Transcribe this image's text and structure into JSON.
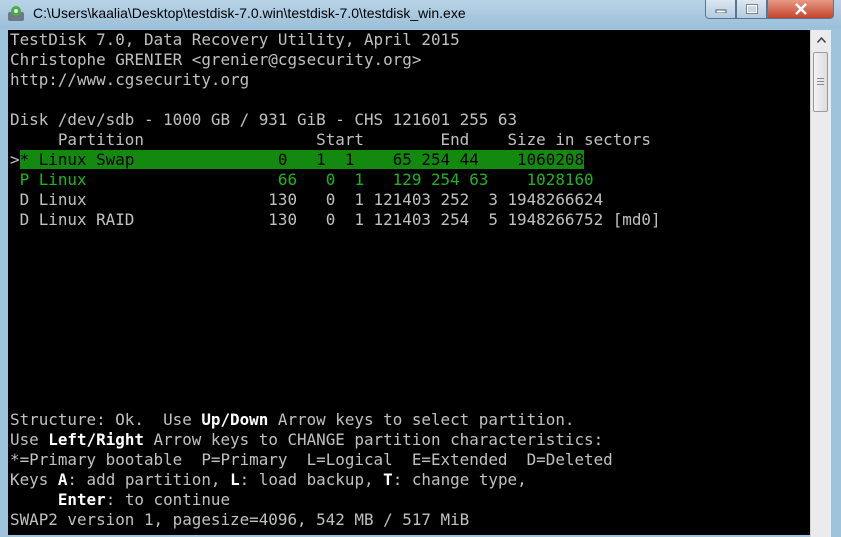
{
  "window": {
    "title": "C:\\Users\\kaalia\\Desktop\\testdisk-7.0.win\\testdisk-7.0\\testdisk_win.exe"
  },
  "console": {
    "header": [
      "TestDisk 7.0, Data Recovery Utility, April 2015",
      "Christophe GRENIER <grenier@cgsecurity.org>",
      "http://www.cgsecurity.org"
    ],
    "disk_line": "Disk /dev/sdb - 1000 GB / 931 GiB - CHS 121601 255 63",
    "table_header": "     Partition                  Start        End    Size in sectors",
    "selected_marker": ">",
    "partitions": [
      {
        "text": "* Linux Swap               0   1  1    65 254 44    1060208",
        "status": "*"
      },
      {
        "text": " P Linux                    66   0  1   129 254 63    1028160",
        "status": "P"
      },
      {
        "text": " D Linux                   130   0  1 121403 252  3 1948266624",
        "status": "D"
      },
      {
        "text": " D Linux RAID              130   0  1 121403 254  5 1948266752 [md0]",
        "status": "D"
      }
    ],
    "help": {
      "l1_a": "Structure: Ok.  Use ",
      "l1_b": "Up/Down",
      "l1_c": " Arrow keys to select partition.",
      "l2_a": "Use ",
      "l2_b": "Left/Right",
      "l2_c": " Arrow keys to CHANGE partition characteristics:",
      "l3": "*=Primary bootable  P=Primary  L=Logical  E=Extended  D=Deleted",
      "l4_a": "Keys ",
      "l4_b": "A",
      "l4_c": ": add partition, ",
      "l4_d": "L",
      "l4_e": ": load backup, ",
      "l4_f": "T",
      "l4_g": ": change type,",
      "l5_a": "     ",
      "l5_b": "Enter",
      "l5_c": ": to continue"
    },
    "status_line": "SWAP2 version 1, pagesize=4096, 542 MB / 517 MiB"
  },
  "colors": {
    "selected_row_bg": "#138a0f",
    "primary_text": "#1cb51c",
    "console_bg": "#000000",
    "console_text": "#c0c0c0"
  },
  "icons": [
    "testdisk-app-icon",
    "minimize-icon",
    "maximize-icon",
    "close-icon",
    "scroll-up-arrow-icon"
  ]
}
